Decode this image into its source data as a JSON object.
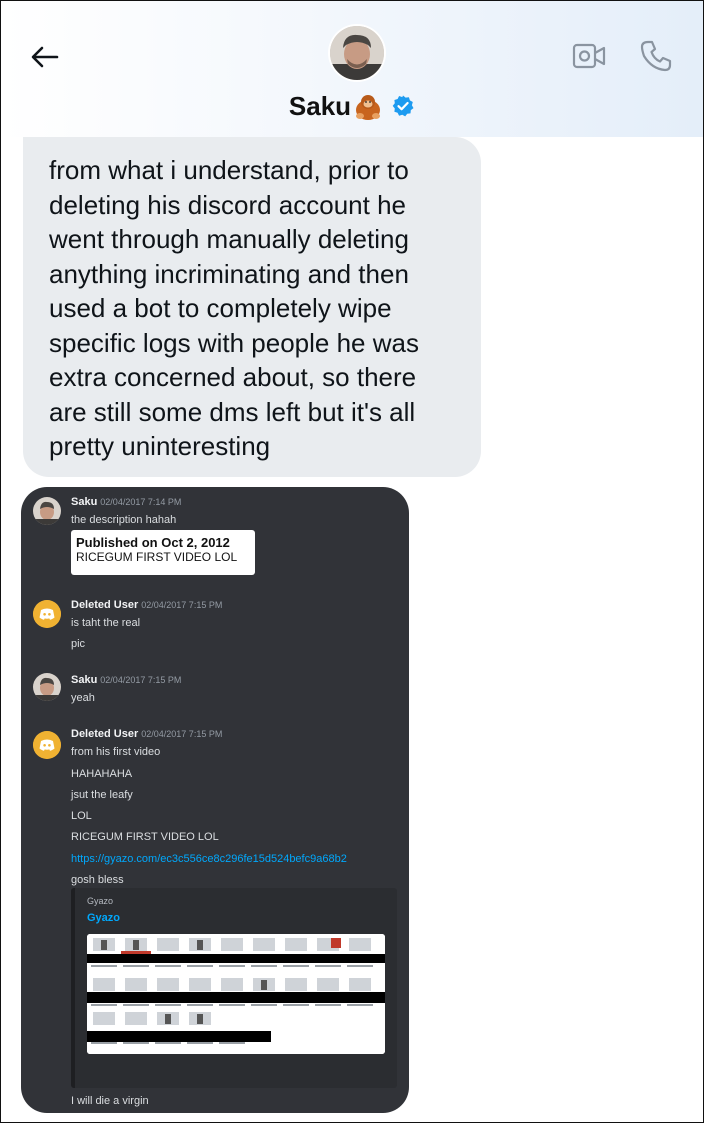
{
  "header": {
    "name": "Saku",
    "name_emoji": "orangutan",
    "icons": [
      "back-arrow-icon",
      "verified-badge-icon",
      "video-call-icon",
      "phone-call-icon"
    ]
  },
  "bubble": {
    "lines": [
      "from what i understand, prior to",
      "deleting his discord account he",
      "went through manually deleting",
      "anything incriminating and then",
      "used a bot to completely wipe",
      "specific logs with people he was",
      "extra concerned about, so there",
      "are still some dms left but it's all",
      "pretty uninteresting"
    ]
  },
  "discord": {
    "messages": [
      {
        "author": "Saku",
        "time": "02/04/2017 7:14 PM",
        "lines": [
          "the description hahah"
        ],
        "embed_text": [
          "Published on Oct 2, 2012",
          "RICEGUM FIRST VIDEO LOL"
        ]
      },
      {
        "author": "Deleted User",
        "time": "02/04/2017 7:15 PM",
        "lines": [
          "is taht the real",
          "pic"
        ]
      },
      {
        "author": "Saku",
        "time": "02/04/2017 7:15 PM",
        "lines": [
          "yeah"
        ]
      },
      {
        "author": "Deleted User",
        "time": "02/04/2017 7:15 PM",
        "lines": [
          "from his first video",
          "HAHAHAHA",
          "jsut the leafy",
          "LOL",
          "RICEGUM FIRST VIDEO LOL"
        ],
        "link": "https://gyazo.com/ec3c556ce8c296fe15d524befc9a68b2",
        "after_link": "gosh bless",
        "embed": {
          "provider": "Gyazo",
          "title": "Gyazo"
        },
        "final_line": "I will die a virgin"
      }
    ]
  },
  "colors": {
    "bubble_bg": "#e9ecef",
    "discord_bg": "#313338",
    "link": "#00a8fc",
    "verified": "#1d9bf0",
    "discord_blurple_orange": "#f0b232"
  }
}
